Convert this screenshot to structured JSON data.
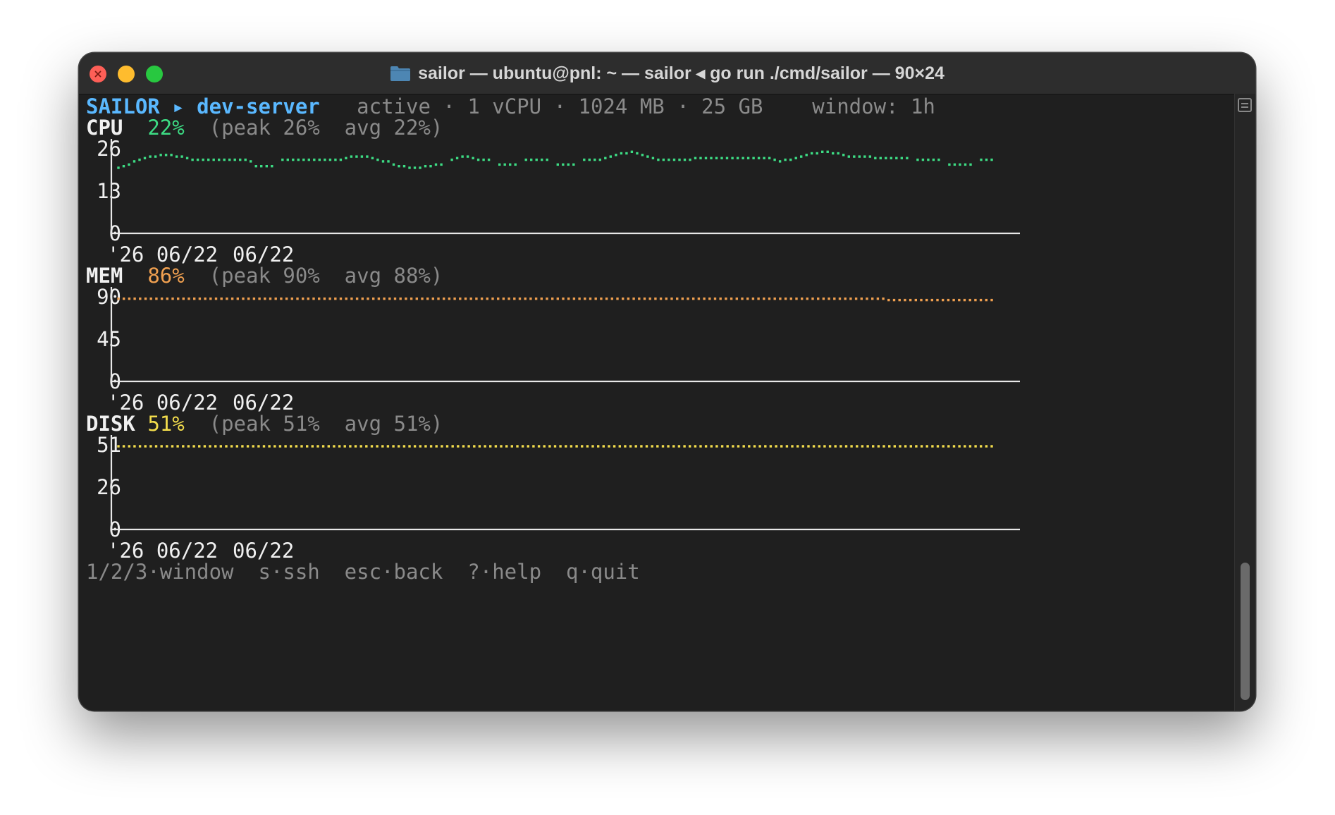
{
  "window": {
    "title": "sailor — ubuntu@pnl: ~ — sailor ◂ go run ./cmd/sailor — 90×24"
  },
  "header": {
    "app": "SAILOR",
    "arrow": "▸",
    "server": "dev-server",
    "status": "active",
    "cpu_count": "1 vCPU",
    "memory": "1024 MB",
    "disk": "25 GB",
    "window_label": "window: 1h",
    "separator": "·"
  },
  "metrics": {
    "cpu": {
      "label": "CPU",
      "value": "22%",
      "stats": "(peak 26%  avg 22%)"
    },
    "mem": {
      "label": "MEM",
      "value": "86%",
      "stats": "(peak 90%  avg 88%)"
    },
    "disk": {
      "label": "DISK",
      "value": "51%",
      "stats": "(peak 51%  avg 51%)"
    }
  },
  "colors": {
    "cpu": "#3ddc84",
    "mem": "#f0a050",
    "disk": "#f2dc4c",
    "axis": "#e8e8e8",
    "accent": "#5ab8ff"
  },
  "chart_data": [
    {
      "type": "line",
      "name": "cpu",
      "yticks": [
        "26",
        "13",
        "0"
      ],
      "ylim": [
        0,
        26
      ],
      "xticks": [
        "'26 06/22",
        "06/22"
      ],
      "grid": false,
      "values": [
        20.5,
        21,
        21.5,
        22.5,
        23,
        23.5,
        24,
        24,
        24.5,
        24.5,
        24.5,
        24,
        24,
        23.5,
        23,
        23,
        23,
        23,
        23,
        23,
        23,
        23,
        23,
        23,
        23,
        22.5,
        21,
        21,
        21,
        21,
        null,
        23,
        23,
        23,
        23,
        23,
        23,
        23,
        23,
        23,
        23,
        23,
        23,
        23.5,
        24,
        24,
        24,
        24,
        23.5,
        23,
        22.5,
        22.5,
        21.5,
        21,
        21,
        20.5,
        20.5,
        20.5,
        21,
        21,
        21.5,
        21.5,
        null,
        23,
        23.5,
        24,
        24,
        23.5,
        23,
        23,
        23,
        null,
        21.5,
        21.5,
        21.5,
        21.5,
        null,
        23,
        23,
        23,
        23,
        23,
        null,
        21.5,
        21.5,
        21.5,
        21.5,
        null,
        23,
        23,
        23,
        23,
        23.5,
        24,
        24.5,
        25,
        25,
        25.5,
        25,
        24.5,
        24,
        23.5,
        23,
        23,
        23,
        23,
        23,
        23,
        23,
        23.5,
        23.5,
        23.5,
        23.5,
        23.5,
        23.5,
        23.5,
        23.5,
        23.5,
        23.5,
        23.5,
        23.5,
        23.5,
        23.5,
        23.5,
        23,
        22.5,
        23,
        23,
        23.5,
        24,
        24.5,
        25,
        25,
        25.5,
        25.5,
        25,
        25,
        24.5,
        24,
        24,
        24,
        24,
        24,
        23.5,
        23.5,
        23.5,
        23.5,
        23.5,
        23.5,
        23.5,
        null,
        23,
        23,
        23,
        23,
        23,
        null,
        21.5,
        21.5,
        21.5,
        21.5,
        21.5,
        null,
        23,
        23,
        23
      ]
    },
    {
      "type": "line",
      "name": "mem",
      "yticks": [
        "90",
        "45",
        "0"
      ],
      "ylim": [
        0,
        90
      ],
      "xticks": [
        "'26 06/22",
        "06/22"
      ],
      "grid": false,
      "values": [
        89.5,
        89.5,
        89.5,
        89.5,
        89.5,
        89.5,
        89.5,
        89.5,
        89.5,
        89.5,
        89.5,
        89.5,
        89.5,
        89.5,
        89.5,
        89.5,
        89.5,
        89.5,
        89.5,
        89.5,
        89.5,
        89.5,
        89.5,
        89.5,
        89.5,
        89.5,
        89.5,
        89.5,
        89.5,
        89.5,
        89.5,
        89.5,
        89.5,
        89.5,
        89.5,
        89.5,
        89.5,
        89.5,
        89.5,
        89.5,
        89.5,
        89.5,
        89.5,
        89.5,
        89.5,
        89.5,
        89.5,
        89.5,
        89.5,
        89.5,
        89.5,
        89.5,
        89.5,
        89.5,
        89.5,
        89.5,
        89.5,
        89.5,
        89.5,
        89.5,
        89.5,
        89.5,
        89.5,
        89.5,
        89.5,
        89.5,
        89.5,
        89.5,
        89.5,
        89.5,
        89.5,
        89.5,
        89.5,
        89.5,
        89.5,
        89.5,
        89.5,
        89.5,
        89.5,
        89.5,
        89.5,
        89.5,
        89.5,
        89.5,
        89.5,
        89.5,
        89.5,
        89.5,
        89.5,
        89.5,
        89.5,
        89.5,
        89.5,
        89.5,
        89.5,
        89.5,
        89.5,
        89.5,
        89.5,
        89.5,
        89.5,
        89.5,
        89.5,
        89.5,
        89.5,
        89.5,
        89.5,
        89.5,
        89.5,
        89.5,
        89.5,
        89.5,
        89.5,
        89.5,
        89.5,
        89.5,
        89.5,
        89.5,
        89.5,
        89.5,
        89.5,
        89.5,
        89.5,
        89.5,
        89.5,
        89.5,
        89.5,
        89.5,
        89.5,
        89.5,
        89.5,
        89.5,
        89.5,
        89.5,
        89.5,
        89.5,
        89.5,
        89.5,
        89.5,
        89.5,
        89.5,
        89.5,
        88,
        88,
        88,
        88,
        88,
        88,
        88,
        88,
        88,
        88,
        88,
        88,
        88,
        88,
        88,
        88,
        88,
        88,
        88,
        88
      ]
    },
    {
      "type": "line",
      "name": "disk",
      "yticks": [
        "51",
        "26",
        "0"
      ],
      "ylim": [
        0,
        51
      ],
      "xticks": [
        "'26 06/22",
        "06/22"
      ],
      "grid": false,
      "values": [
        51,
        51,
        51,
        51,
        51,
        51,
        51,
        51,
        51,
        51,
        51,
        51,
        51,
        51,
        51,
        51,
        51,
        51,
        51,
        51,
        51,
        51,
        51,
        51,
        51,
        51,
        51,
        51,
        51,
        51,
        51,
        51,
        51,
        51,
        51,
        51,
        51,
        51,
        51,
        51,
        51,
        51,
        51,
        51,
        51,
        51,
        51,
        51,
        51,
        51,
        51,
        51,
        51,
        51,
        51,
        51,
        51,
        51,
        51,
        51,
        51,
        51,
        51,
        51,
        51,
        51,
        51,
        51,
        51,
        51,
        51,
        51,
        51,
        51,
        51,
        51,
        51,
        51,
        51,
        51,
        51,
        51,
        51,
        51,
        51,
        51,
        51,
        51,
        51,
        51,
        51,
        51,
        51,
        51,
        51,
        51,
        51,
        51,
        51,
        51,
        51,
        51,
        51,
        51,
        51,
        51,
        51,
        51,
        51,
        51,
        51,
        51,
        51,
        51,
        51,
        51,
        51,
        51,
        51,
        51,
        51,
        51,
        51,
        51,
        51,
        51,
        51,
        51,
        51,
        51,
        51,
        51,
        51,
        51,
        51,
        51,
        51,
        51,
        51,
        51,
        51,
        51,
        51,
        51,
        51,
        51,
        51,
        51,
        51,
        51,
        51,
        51,
        51,
        51,
        51,
        51,
        51,
        51,
        51,
        51,
        51,
        51,
        51
      ]
    }
  ],
  "footer": {
    "hint1": "1/2/3·window",
    "hint2": "s·ssh",
    "hint3": "esc·back",
    "hint4": "?·help",
    "hint5": "q·quit"
  }
}
